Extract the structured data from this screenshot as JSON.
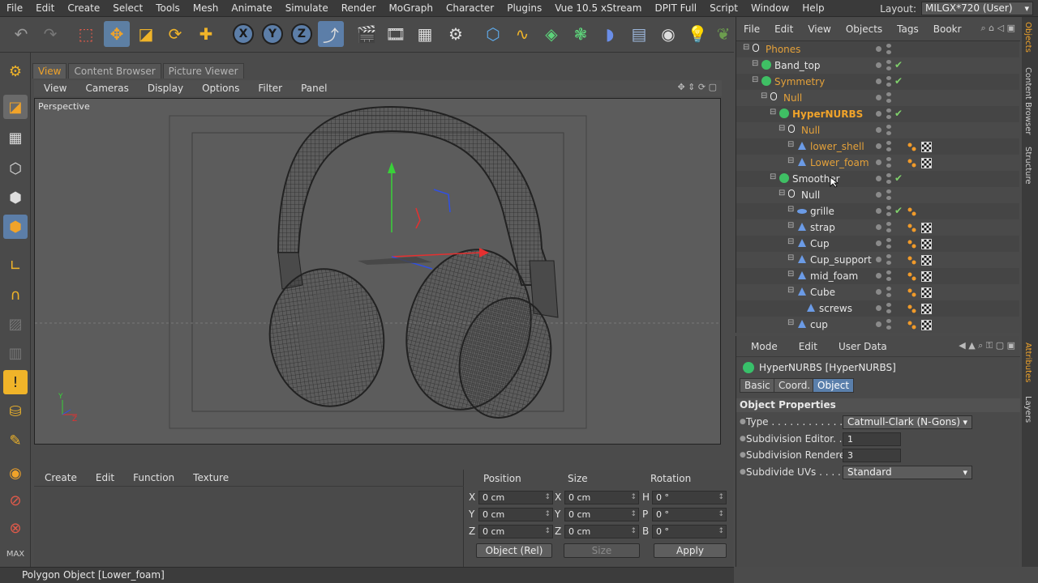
{
  "menubar": [
    "File",
    "Edit",
    "Create",
    "Select",
    "Tools",
    "Mesh",
    "Animate",
    "Simulate",
    "Render",
    "MoGraph",
    "Character",
    "Plugins",
    "Vue 10.5 xStream",
    "DPIT Full",
    "Script",
    "Window",
    "Help"
  ],
  "layout": {
    "label": "Layout:",
    "value": "MILGX*720 (User)"
  },
  "toolbar": {
    "x_label": "X",
    "y_label": "Y",
    "z_label": "Z"
  },
  "view_tabs": [
    "View",
    "Content Browser",
    "Picture Viewer"
  ],
  "viewport_menu": [
    "View",
    "Cameras",
    "Display",
    "Options",
    "Filter",
    "Panel"
  ],
  "viewport": {
    "name": "Perspective"
  },
  "bottom_panel": {
    "menu": [
      "Create",
      "Edit",
      "Function",
      "Texture"
    ]
  },
  "coordinates": {
    "headers": [
      "Position",
      "Size",
      "Rotation"
    ],
    "rows": [
      {
        "pl": "X",
        "p": "0 cm",
        "sl": "X",
        "s": "0 cm",
        "rl": "H",
        "r": "0 °"
      },
      {
        "pl": "Y",
        "p": "0 cm",
        "sl": "Y",
        "s": "0 cm",
        "rl": "P",
        "r": "0 °"
      },
      {
        "pl": "Z",
        "p": "0 cm",
        "sl": "Z",
        "s": "0 cm",
        "rl": "B",
        "r": "0 °"
      }
    ],
    "mode": "Object (Rel)",
    "size_mode": "Size",
    "apply": "Apply"
  },
  "status": "Polygon Object [Lower_foam]",
  "object_manager": {
    "menu": [
      "File",
      "Edit",
      "View",
      "Objects",
      "Tags",
      "Bookr"
    ],
    "objects": [
      {
        "name": "Phones",
        "indent": 0,
        "icon": "null",
        "color": "#e4a13a",
        "check": false,
        "tags": 0
      },
      {
        "name": "Band_top",
        "indent": 1,
        "icon": "gear",
        "color": "#e6e6e6",
        "check": true,
        "tags": 0
      },
      {
        "name": "Symmetry",
        "indent": 1,
        "icon": "gear",
        "color": "#e4a13a",
        "check": true,
        "tags": 0
      },
      {
        "name": "Null",
        "indent": 2,
        "icon": "null",
        "color": "#e4a13a",
        "check": false,
        "tags": 0
      },
      {
        "name": "HyperNURBS",
        "indent": 3,
        "icon": "gear",
        "color": "#f0a32a",
        "check": true,
        "tags": 0
      },
      {
        "name": "Null",
        "indent": 4,
        "icon": "null",
        "color": "#e4a13a",
        "check": false,
        "tags": 0
      },
      {
        "name": "lower_shell",
        "indent": 5,
        "icon": "poly",
        "color": "#e4a13a",
        "check": false,
        "tags": 2
      },
      {
        "name": "Lower_foam",
        "indent": 5,
        "icon": "poly",
        "color": "#e4a13a",
        "check": false,
        "tags": 2
      },
      {
        "name": "Smoother",
        "indent": 3,
        "icon": "gear",
        "color": "#e6e6e6",
        "check": true,
        "tags": 0
      },
      {
        "name": "Null",
        "indent": 4,
        "icon": "null",
        "color": "#e6e6e6",
        "check": false,
        "tags": 0
      },
      {
        "name": "grille",
        "indent": 5,
        "icon": "disc",
        "color": "#e6e6e6",
        "check": true,
        "tags": 1
      },
      {
        "name": "strap",
        "indent": 5,
        "icon": "poly",
        "color": "#e6e6e6",
        "check": false,
        "tags": 2
      },
      {
        "name": "Cup",
        "indent": 5,
        "icon": "poly",
        "color": "#e6e6e6",
        "check": false,
        "tags": 2
      },
      {
        "name": "Cup_support",
        "indent": 5,
        "icon": "poly",
        "color": "#e6e6e6",
        "check": false,
        "tags": 2
      },
      {
        "name": "mid_foam",
        "indent": 5,
        "icon": "poly",
        "color": "#e6e6e6",
        "check": false,
        "tags": 2
      },
      {
        "name": "Cube",
        "indent": 5,
        "icon": "poly",
        "color": "#e6e6e6",
        "check": false,
        "tags": 2
      },
      {
        "name": "screws",
        "indent": 6,
        "icon": "poly",
        "color": "#e6e6e6",
        "check": false,
        "tags": 2
      },
      {
        "name": "cup",
        "indent": 5,
        "icon": "poly",
        "color": "#e6e6e6",
        "check": false,
        "tags": 2
      }
    ]
  },
  "side_tabs": [
    "Objects",
    "Content Browser",
    "Structure"
  ],
  "side_tabs_bottom": [
    "Attributes",
    "Layers"
  ],
  "attributes": {
    "menu": [
      "Mode",
      "Edit",
      "User Data"
    ],
    "title": "HyperNURBS [HyperNURBS]",
    "tabs": [
      "Basic",
      "Coord.",
      "Object"
    ],
    "section": "Object Properties",
    "props": [
      {
        "label": "Type . . . . . . . . . . . . . .",
        "value": "Catmull-Clark (N-Gons)",
        "kind": "drop"
      },
      {
        "label": "Subdivision Editor. . .",
        "value": "1",
        "kind": "num"
      },
      {
        "label": "Subdivision Renderer",
        "value": "3",
        "kind": "num"
      },
      {
        "label": "Subdivide UVs . . . . . .",
        "value": "Standard",
        "kind": "drop"
      }
    ]
  }
}
